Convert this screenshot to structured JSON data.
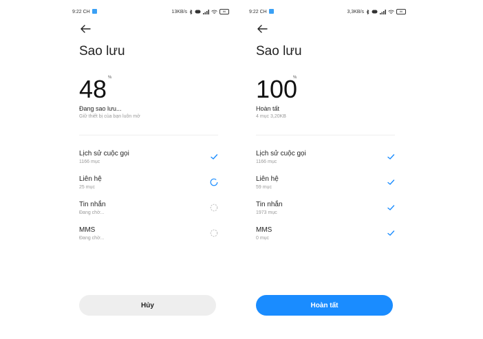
{
  "left": {
    "status": {
      "time": "9:22 CH",
      "speed": "13KB/s",
      "battery": "86"
    },
    "title": "Sao lưu",
    "progress_value": "48",
    "percent_sign": "%",
    "state_text": "Đang sao lưu...",
    "sub_text": "Giữ thiết bị của bạn luôn mở",
    "items": [
      {
        "name": "Lịch sử cuộc gọi",
        "count": "1166 mục",
        "state": "done"
      },
      {
        "name": "Liên hệ",
        "count": "25 mục",
        "state": "in-progress"
      },
      {
        "name": "Tin nhắn",
        "count": "Đang chờ...",
        "state": "waiting"
      },
      {
        "name": "MMS",
        "count": "Đang chờ...",
        "state": "waiting"
      }
    ],
    "button_label": "Hủy"
  },
  "right": {
    "status": {
      "time": "9:22 CH",
      "speed": "3,3KB/s",
      "battery": "86"
    },
    "title": "Sao lưu",
    "progress_value": "100",
    "percent_sign": "%",
    "state_text": "Hoàn tất",
    "sub_text": "4 mục 3,20KB",
    "items": [
      {
        "name": "Lịch sử cuộc gọi",
        "count": "1166 mục",
        "state": "done"
      },
      {
        "name": "Liên hệ",
        "count": "59 mục",
        "state": "done"
      },
      {
        "name": "Tin nhắn",
        "count": "1973 mục",
        "state": "done"
      },
      {
        "name": "MMS",
        "count": "0 mục",
        "state": "done"
      }
    ],
    "button_label": "Hoàn tất"
  },
  "colors": {
    "accent": "#1a8cff",
    "check": "#1a8cff",
    "waiting": "#bbbbbb",
    "grey_button": "#eeeeee"
  },
  "icons": {
    "back": "arrow-left-icon",
    "done": "check-icon",
    "in_progress": "spinner-icon",
    "waiting": "dotted-circle-icon"
  }
}
